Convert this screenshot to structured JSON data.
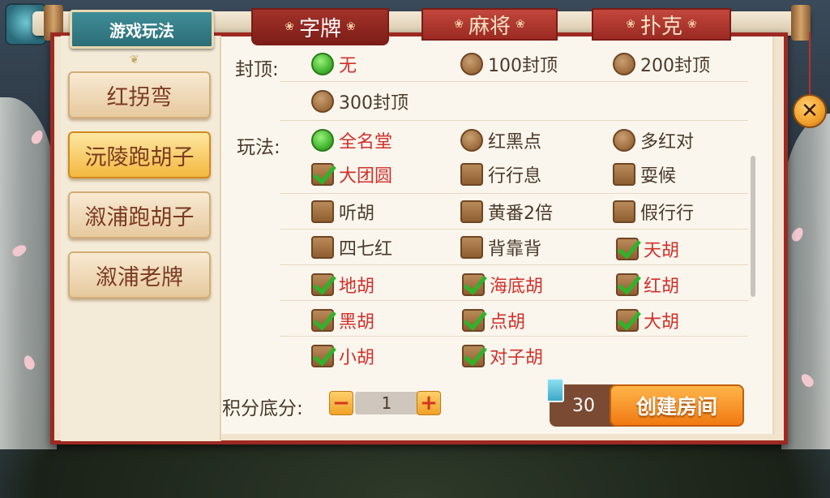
{
  "header": {
    "title": "游戏玩法"
  },
  "tabs": [
    {
      "label": "字牌",
      "active": true
    },
    {
      "label": "麻将",
      "active": false
    },
    {
      "label": "扑克",
      "active": false
    }
  ],
  "sidebar": {
    "items": [
      {
        "label": "红拐弯",
        "active": false
      },
      {
        "label": "沅陵跑胡子",
        "active": true
      },
      {
        "label": "溆浦跑胡子",
        "active": false
      },
      {
        "label": "溆浦老牌",
        "active": false
      }
    ]
  },
  "cap": {
    "label": "封顶:",
    "options": [
      {
        "label": "无",
        "selected": true
      },
      {
        "label": "100封顶",
        "selected": false
      },
      {
        "label": "200封顶",
        "selected": false
      },
      {
        "label": "300封顶",
        "selected": false
      }
    ]
  },
  "play": {
    "label": "玩法:",
    "radio_options": [
      {
        "label": "全名堂",
        "selected": true
      },
      {
        "label": "红黑点",
        "selected": false
      },
      {
        "label": "多红对",
        "selected": false
      }
    ],
    "checkbox_options": [
      {
        "label": "大团圆",
        "checked": true
      },
      {
        "label": "行行息",
        "checked": false
      },
      {
        "label": "耍候",
        "checked": false
      },
      {
        "label": "听胡",
        "checked": false
      },
      {
        "label": "黄番2倍",
        "checked": false
      },
      {
        "label": "假行行",
        "checked": false
      },
      {
        "label": "四七红",
        "checked": false
      },
      {
        "label": "背靠背",
        "checked": false
      },
      {
        "label": "天胡",
        "checked": true
      },
      {
        "label": "地胡",
        "checked": true
      },
      {
        "label": "海底胡",
        "checked": true
      },
      {
        "label": "红胡",
        "checked": true
      },
      {
        "label": "黑胡",
        "checked": true
      },
      {
        "label": "点胡",
        "checked": true
      },
      {
        "label": "大胡",
        "checked": true
      },
      {
        "label": "小胡",
        "checked": true
      },
      {
        "label": "对子胡",
        "checked": true
      }
    ]
  },
  "score": {
    "label": "积分底分:",
    "minus": "−",
    "value": "1",
    "plus": "+"
  },
  "footer": {
    "cost": "30",
    "create_label": "创建房间"
  },
  "close": {
    "label": "✕"
  },
  "colors": {
    "selected_text": "#d0302c",
    "tab_red": "#9b2a23",
    "accent_orange": "#f07a12"
  }
}
